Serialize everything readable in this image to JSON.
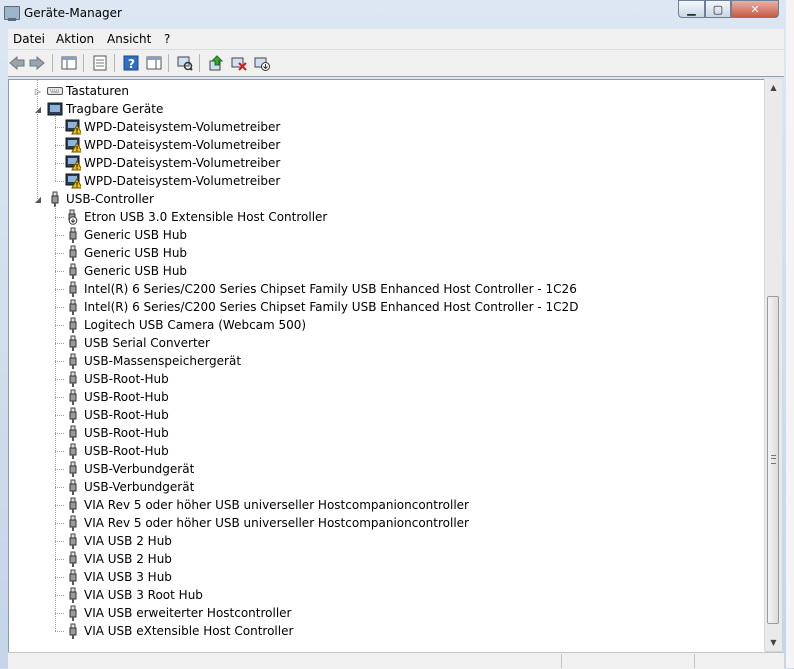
{
  "window": {
    "title": "Geräte-Manager"
  },
  "window_controls": {
    "minimize": "▁",
    "maximize": "▢",
    "close": "✕"
  },
  "menu": [
    "Datei",
    "Aktion",
    "Ansicht",
    "?"
  ],
  "toolbar_icons": [
    "back-arrow-icon",
    "forward-arrow-icon",
    "show-hide-console-tree-icon",
    "properties-icon",
    "help-icon",
    "action-pane-icon",
    "scan-hardware-icon",
    "update-driver-icon",
    "uninstall-device-icon",
    "disable-device-icon"
  ],
  "tree": {
    "categories": [
      {
        "label": "Tastaturen",
        "expanded": false,
        "icon": "keyboard-icon",
        "children": []
      },
      {
        "label": "Tragbare Geräte",
        "expanded": true,
        "icon": "portable-device-icon",
        "children": [
          {
            "label": "WPD-Dateisystem-Volumetreiber",
            "icon": "portable-device-warning-icon"
          },
          {
            "label": "WPD-Dateisystem-Volumetreiber",
            "icon": "portable-device-warning-icon"
          },
          {
            "label": "WPD-Dateisystem-Volumetreiber",
            "icon": "portable-device-warning-icon"
          },
          {
            "label": "WPD-Dateisystem-Volumetreiber",
            "icon": "portable-device-warning-icon"
          }
        ]
      },
      {
        "label": "USB-Controller",
        "expanded": true,
        "icon": "usb-plug-icon",
        "children": [
          {
            "label": "Etron USB 3.0 Extensible Host Controller",
            "icon": "usb-disabled-icon"
          },
          {
            "label": "Generic USB Hub",
            "icon": "usb-plug-icon"
          },
          {
            "label": "Generic USB Hub",
            "icon": "usb-plug-icon"
          },
          {
            "label": "Generic USB Hub",
            "icon": "usb-plug-icon"
          },
          {
            "label": "Intel(R) 6 Series/C200 Series Chipset Family USB Enhanced Host Controller - 1C26",
            "icon": "usb-plug-icon"
          },
          {
            "label": "Intel(R) 6 Series/C200 Series Chipset Family USB Enhanced Host Controller - 1C2D",
            "icon": "usb-plug-icon"
          },
          {
            "label": "Logitech USB Camera (Webcam 500)",
            "icon": "usb-plug-icon"
          },
          {
            "label": "USB Serial Converter",
            "icon": "usb-plug-icon"
          },
          {
            "label": "USB-Massenspeichergerät",
            "icon": "usb-plug-icon"
          },
          {
            "label": "USB-Root-Hub",
            "icon": "usb-plug-icon"
          },
          {
            "label": "USB-Root-Hub",
            "icon": "usb-plug-icon"
          },
          {
            "label": "USB-Root-Hub",
            "icon": "usb-plug-icon"
          },
          {
            "label": "USB-Root-Hub",
            "icon": "usb-plug-icon"
          },
          {
            "label": "USB-Root-Hub",
            "icon": "usb-plug-icon"
          },
          {
            "label": "USB-Verbundgerät",
            "icon": "usb-plug-icon"
          },
          {
            "label": "USB-Verbundgerät",
            "icon": "usb-plug-icon"
          },
          {
            "label": "VIA Rev 5 oder höher USB universeller Hostcompanioncontroller",
            "icon": "usb-plug-icon"
          },
          {
            "label": "VIA Rev 5 oder höher USB universeller Hostcompanioncontroller",
            "icon": "usb-plug-icon"
          },
          {
            "label": "VIA USB 2 Hub",
            "icon": "usb-plug-icon"
          },
          {
            "label": "VIA USB 2 Hub",
            "icon": "usb-plug-icon"
          },
          {
            "label": "VIA USB 3 Hub",
            "icon": "usb-plug-icon"
          },
          {
            "label": "VIA USB 3 Root Hub",
            "icon": "usb-plug-icon"
          },
          {
            "label": "VIA USB erweiterter Hostcontroller",
            "icon": "usb-plug-icon"
          },
          {
            "label": "VIA USB eXtensible Host Controller",
            "icon": "usb-plug-icon"
          }
        ]
      }
    ]
  },
  "scrollbar": {
    "up": "▲",
    "down": "▼",
    "position": 0.95
  },
  "colors": {
    "window_frame": "#cfdbe8",
    "client_bg": "#ffffff",
    "warning": "#f5c400",
    "disabled_arrow": "#333333"
  }
}
